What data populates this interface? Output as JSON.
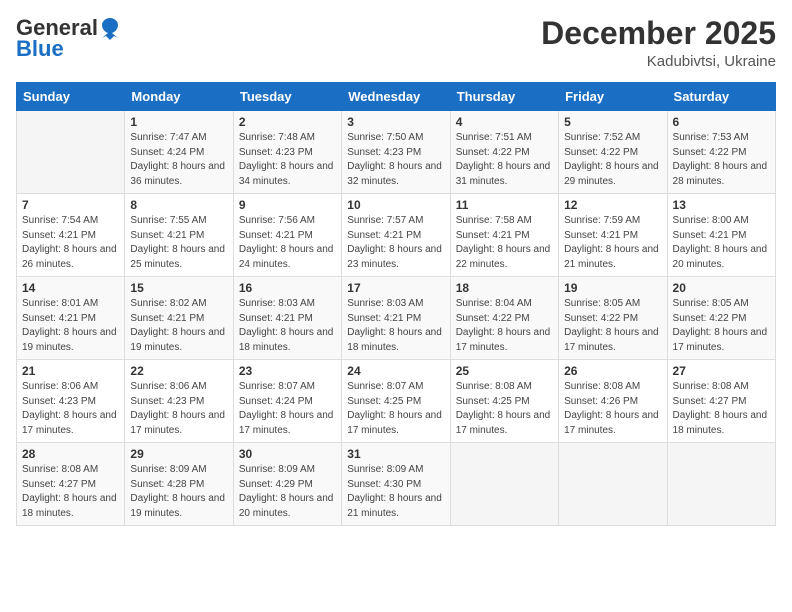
{
  "header": {
    "logo_general": "General",
    "logo_blue": "Blue",
    "month_title": "December 2025",
    "location": "Kadubivtsi, Ukraine"
  },
  "days_of_week": [
    "Sunday",
    "Monday",
    "Tuesday",
    "Wednesday",
    "Thursday",
    "Friday",
    "Saturday"
  ],
  "weeks": [
    [
      {
        "day": "",
        "sunrise": "",
        "sunset": "",
        "daylight": ""
      },
      {
        "day": "1",
        "sunrise": "Sunrise: 7:47 AM",
        "sunset": "Sunset: 4:24 PM",
        "daylight": "Daylight: 8 hours and 36 minutes."
      },
      {
        "day": "2",
        "sunrise": "Sunrise: 7:48 AM",
        "sunset": "Sunset: 4:23 PM",
        "daylight": "Daylight: 8 hours and 34 minutes."
      },
      {
        "day": "3",
        "sunrise": "Sunrise: 7:50 AM",
        "sunset": "Sunset: 4:23 PM",
        "daylight": "Daylight: 8 hours and 32 minutes."
      },
      {
        "day": "4",
        "sunrise": "Sunrise: 7:51 AM",
        "sunset": "Sunset: 4:22 PM",
        "daylight": "Daylight: 8 hours and 31 minutes."
      },
      {
        "day": "5",
        "sunrise": "Sunrise: 7:52 AM",
        "sunset": "Sunset: 4:22 PM",
        "daylight": "Daylight: 8 hours and 29 minutes."
      },
      {
        "day": "6",
        "sunrise": "Sunrise: 7:53 AM",
        "sunset": "Sunset: 4:22 PM",
        "daylight": "Daylight: 8 hours and 28 minutes."
      }
    ],
    [
      {
        "day": "7",
        "sunrise": "Sunrise: 7:54 AM",
        "sunset": "Sunset: 4:21 PM",
        "daylight": "Daylight: 8 hours and 26 minutes."
      },
      {
        "day": "8",
        "sunrise": "Sunrise: 7:55 AM",
        "sunset": "Sunset: 4:21 PM",
        "daylight": "Daylight: 8 hours and 25 minutes."
      },
      {
        "day": "9",
        "sunrise": "Sunrise: 7:56 AM",
        "sunset": "Sunset: 4:21 PM",
        "daylight": "Daylight: 8 hours and 24 minutes."
      },
      {
        "day": "10",
        "sunrise": "Sunrise: 7:57 AM",
        "sunset": "Sunset: 4:21 PM",
        "daylight": "Daylight: 8 hours and 23 minutes."
      },
      {
        "day": "11",
        "sunrise": "Sunrise: 7:58 AM",
        "sunset": "Sunset: 4:21 PM",
        "daylight": "Daylight: 8 hours and 22 minutes."
      },
      {
        "day": "12",
        "sunrise": "Sunrise: 7:59 AM",
        "sunset": "Sunset: 4:21 PM",
        "daylight": "Daylight: 8 hours and 21 minutes."
      },
      {
        "day": "13",
        "sunrise": "Sunrise: 8:00 AM",
        "sunset": "Sunset: 4:21 PM",
        "daylight": "Daylight: 8 hours and 20 minutes."
      }
    ],
    [
      {
        "day": "14",
        "sunrise": "Sunrise: 8:01 AM",
        "sunset": "Sunset: 4:21 PM",
        "daylight": "Daylight: 8 hours and 19 minutes."
      },
      {
        "day": "15",
        "sunrise": "Sunrise: 8:02 AM",
        "sunset": "Sunset: 4:21 PM",
        "daylight": "Daylight: 8 hours and 19 minutes."
      },
      {
        "day": "16",
        "sunrise": "Sunrise: 8:03 AM",
        "sunset": "Sunset: 4:21 PM",
        "daylight": "Daylight: 8 hours and 18 minutes."
      },
      {
        "day": "17",
        "sunrise": "Sunrise: 8:03 AM",
        "sunset": "Sunset: 4:21 PM",
        "daylight": "Daylight: 8 hours and 18 minutes."
      },
      {
        "day": "18",
        "sunrise": "Sunrise: 8:04 AM",
        "sunset": "Sunset: 4:22 PM",
        "daylight": "Daylight: 8 hours and 17 minutes."
      },
      {
        "day": "19",
        "sunrise": "Sunrise: 8:05 AM",
        "sunset": "Sunset: 4:22 PM",
        "daylight": "Daylight: 8 hours and 17 minutes."
      },
      {
        "day": "20",
        "sunrise": "Sunrise: 8:05 AM",
        "sunset": "Sunset: 4:22 PM",
        "daylight": "Daylight: 8 hours and 17 minutes."
      }
    ],
    [
      {
        "day": "21",
        "sunrise": "Sunrise: 8:06 AM",
        "sunset": "Sunset: 4:23 PM",
        "daylight": "Daylight: 8 hours and 17 minutes."
      },
      {
        "day": "22",
        "sunrise": "Sunrise: 8:06 AM",
        "sunset": "Sunset: 4:23 PM",
        "daylight": "Daylight: 8 hours and 17 minutes."
      },
      {
        "day": "23",
        "sunrise": "Sunrise: 8:07 AM",
        "sunset": "Sunset: 4:24 PM",
        "daylight": "Daylight: 8 hours and 17 minutes."
      },
      {
        "day": "24",
        "sunrise": "Sunrise: 8:07 AM",
        "sunset": "Sunset: 4:25 PM",
        "daylight": "Daylight: 8 hours and 17 minutes."
      },
      {
        "day": "25",
        "sunrise": "Sunrise: 8:08 AM",
        "sunset": "Sunset: 4:25 PM",
        "daylight": "Daylight: 8 hours and 17 minutes."
      },
      {
        "day": "26",
        "sunrise": "Sunrise: 8:08 AM",
        "sunset": "Sunset: 4:26 PM",
        "daylight": "Daylight: 8 hours and 17 minutes."
      },
      {
        "day": "27",
        "sunrise": "Sunrise: 8:08 AM",
        "sunset": "Sunset: 4:27 PM",
        "daylight": "Daylight: 8 hours and 18 minutes."
      }
    ],
    [
      {
        "day": "28",
        "sunrise": "Sunrise: 8:08 AM",
        "sunset": "Sunset: 4:27 PM",
        "daylight": "Daylight: 8 hours and 18 minutes."
      },
      {
        "day": "29",
        "sunrise": "Sunrise: 8:09 AM",
        "sunset": "Sunset: 4:28 PM",
        "daylight": "Daylight: 8 hours and 19 minutes."
      },
      {
        "day": "30",
        "sunrise": "Sunrise: 8:09 AM",
        "sunset": "Sunset: 4:29 PM",
        "daylight": "Daylight: 8 hours and 20 minutes."
      },
      {
        "day": "31",
        "sunrise": "Sunrise: 8:09 AM",
        "sunset": "Sunset: 4:30 PM",
        "daylight": "Daylight: 8 hours and 21 minutes."
      },
      {
        "day": "",
        "sunrise": "",
        "sunset": "",
        "daylight": ""
      },
      {
        "day": "",
        "sunrise": "",
        "sunset": "",
        "daylight": ""
      },
      {
        "day": "",
        "sunrise": "",
        "sunset": "",
        "daylight": ""
      }
    ]
  ]
}
